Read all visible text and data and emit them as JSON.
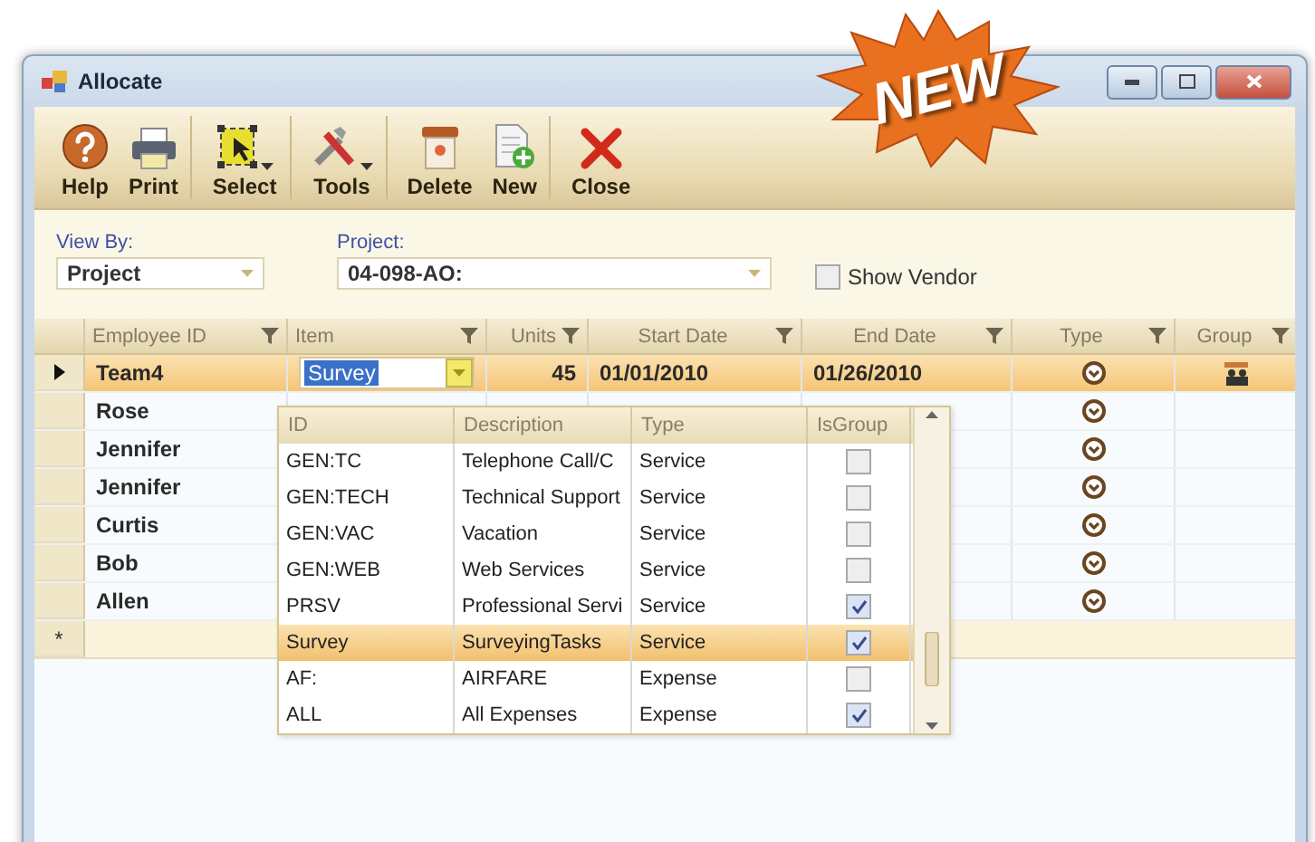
{
  "badge": {
    "text": "NEW"
  },
  "window": {
    "title": "Allocate"
  },
  "toolbar": {
    "buttons": [
      {
        "label": "Help",
        "kind": "help",
        "has_menu": false,
        "separator_after": false
      },
      {
        "label": "Print",
        "kind": "print",
        "has_menu": false,
        "separator_after": true
      },
      {
        "label": "Select",
        "kind": "select",
        "has_menu": true,
        "separator_after": true
      },
      {
        "label": "Tools",
        "kind": "tools",
        "has_menu": true,
        "separator_after": true
      },
      {
        "label": "Delete",
        "kind": "delete",
        "has_menu": false,
        "separator_after": false
      },
      {
        "label": "New",
        "kind": "new",
        "has_menu": false,
        "separator_after": true
      },
      {
        "label": "Close",
        "kind": "close",
        "has_menu": false,
        "separator_after": false
      }
    ]
  },
  "filters": {
    "view_by": {
      "label": "View By:",
      "value": "Project"
    },
    "project": {
      "label": "Project:",
      "value": "04-098-AO:"
    },
    "show_vendor": {
      "label": "Show Vendor",
      "checked": false
    }
  },
  "grid": {
    "columns": [
      {
        "label": "Employee ID"
      },
      {
        "label": "Item"
      },
      {
        "label": "Units"
      },
      {
        "label": "Start Date"
      },
      {
        "label": "End Date"
      },
      {
        "label": "Type"
      },
      {
        "label": "Group"
      }
    ],
    "rows": [
      {
        "employee_id": "Team4",
        "item": "Survey",
        "units": "45",
        "start_date": "01/01/2010",
        "end_date": "01/26/2010",
        "has_type": true,
        "grouped": true,
        "selected": true
      },
      {
        "employee_id": "Rose",
        "has_type": true,
        "grouped": false,
        "selected": false
      },
      {
        "employee_id": "Jennifer",
        "has_type": true,
        "grouped": false,
        "selected": false
      },
      {
        "employee_id": "Jennifer",
        "has_type": true,
        "grouped": false,
        "selected": false
      },
      {
        "employee_id": "Curtis",
        "has_type": true,
        "grouped": false,
        "selected": false
      },
      {
        "employee_id": "Bob",
        "has_type": true,
        "grouped": false,
        "selected": false
      },
      {
        "employee_id": "Allen",
        "has_type": true,
        "grouped": false,
        "selected": false
      }
    ],
    "new_row_marker": "*"
  },
  "item_dropdown": {
    "columns": [
      "ID",
      "Description",
      "Type",
      "IsGroup"
    ],
    "rows": [
      {
        "id": "GEN:TC",
        "description": "Telephone Call/C",
        "type": "Service",
        "is_group": false,
        "selected": false
      },
      {
        "id": "GEN:TECH",
        "description": "Technical Support",
        "type": "Service",
        "is_group": false,
        "selected": false
      },
      {
        "id": "GEN:VAC",
        "description": "Vacation",
        "type": "Service",
        "is_group": false,
        "selected": false
      },
      {
        "id": "GEN:WEB",
        "description": "Web Services",
        "type": "Service",
        "is_group": false,
        "selected": false
      },
      {
        "id": "PRSV",
        "description": "Professional Servi",
        "type": "Service",
        "is_group": true,
        "selected": false
      },
      {
        "id": "Survey",
        "description": "SurveyingTasks",
        "type": "Service",
        "is_group": true,
        "selected": true
      },
      {
        "id": "AF:",
        "description": "AIRFARE",
        "type": "Expense",
        "is_group": false,
        "selected": false
      },
      {
        "id": "ALL",
        "description": "All Expenses",
        "type": "Expense",
        "is_group": true,
        "selected": false
      }
    ]
  }
}
